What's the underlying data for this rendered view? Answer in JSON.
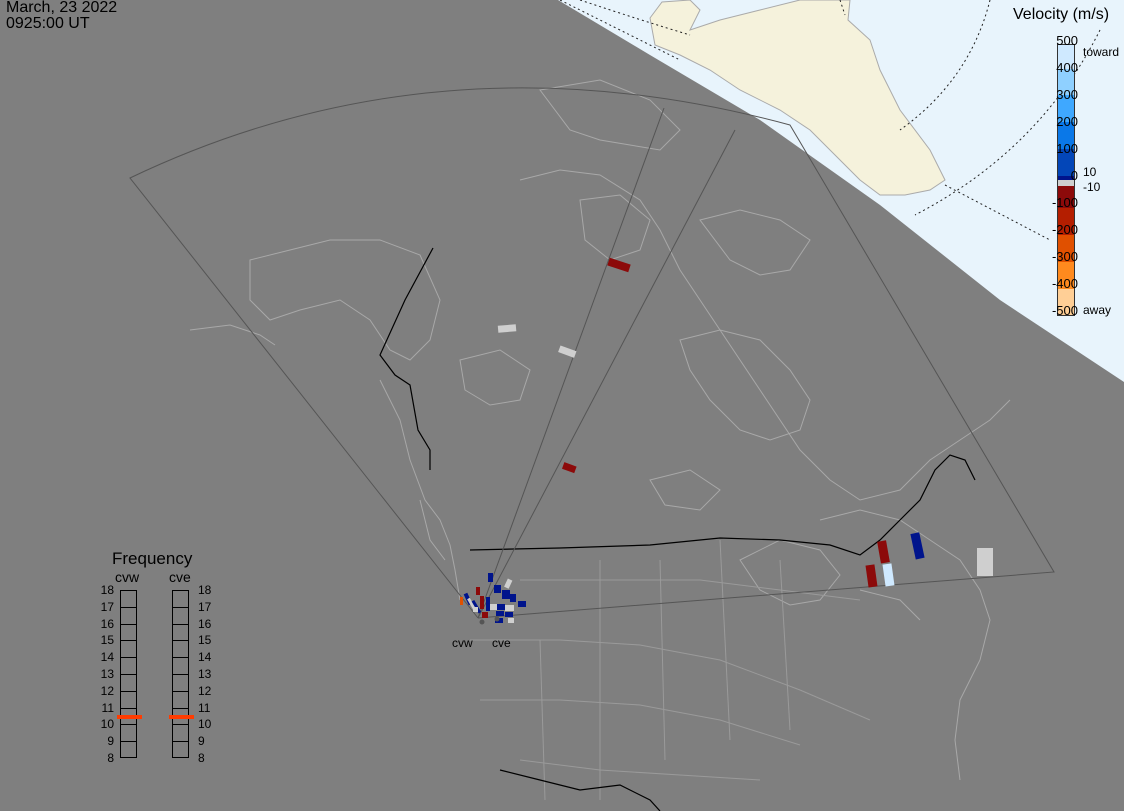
{
  "header": {
    "date": "March, 23 2022",
    "time": "0925:00 UT"
  },
  "velocity_scale": {
    "title": "Velocity (m/s)",
    "ticks": [
      "500",
      "400",
      "300",
      "200",
      "100",
      "0",
      "-100",
      "-200",
      "-300",
      "-400",
      "-500"
    ],
    "toward_label": "toward",
    "away_label": "away",
    "mid_pos": "10",
    "mid_neg": "-10",
    "colors": [
      "#cfe9ff",
      "#8fd0ff",
      "#3fa8ff",
      "#0a78e8",
      "#0346b8",
      "#00148c",
      "#cfcfcf",
      "#8c0a0a",
      "#b41e00",
      "#e05000",
      "#ff8a1e",
      "#ffcf96"
    ]
  },
  "frequency_panel": {
    "title": "Frequency",
    "radars": [
      "cvw",
      "cve"
    ],
    "values": [
      "18",
      "17",
      "16",
      "15",
      "14",
      "13",
      "12",
      "11",
      "10",
      "9",
      "8"
    ],
    "cvw_mhz": 10.5,
    "cve_mhz": 10.5,
    "marker_color": "#ff3c00"
  },
  "sites": {
    "west": "cvw",
    "east": "cve"
  },
  "map_colors": {
    "night": "#7f7f7f",
    "day_ocean": "#e8f4fc",
    "greenland": "#f5f2dc",
    "coast": "#a8a8a8",
    "border": "#000000",
    "fov": "#555555"
  }
}
